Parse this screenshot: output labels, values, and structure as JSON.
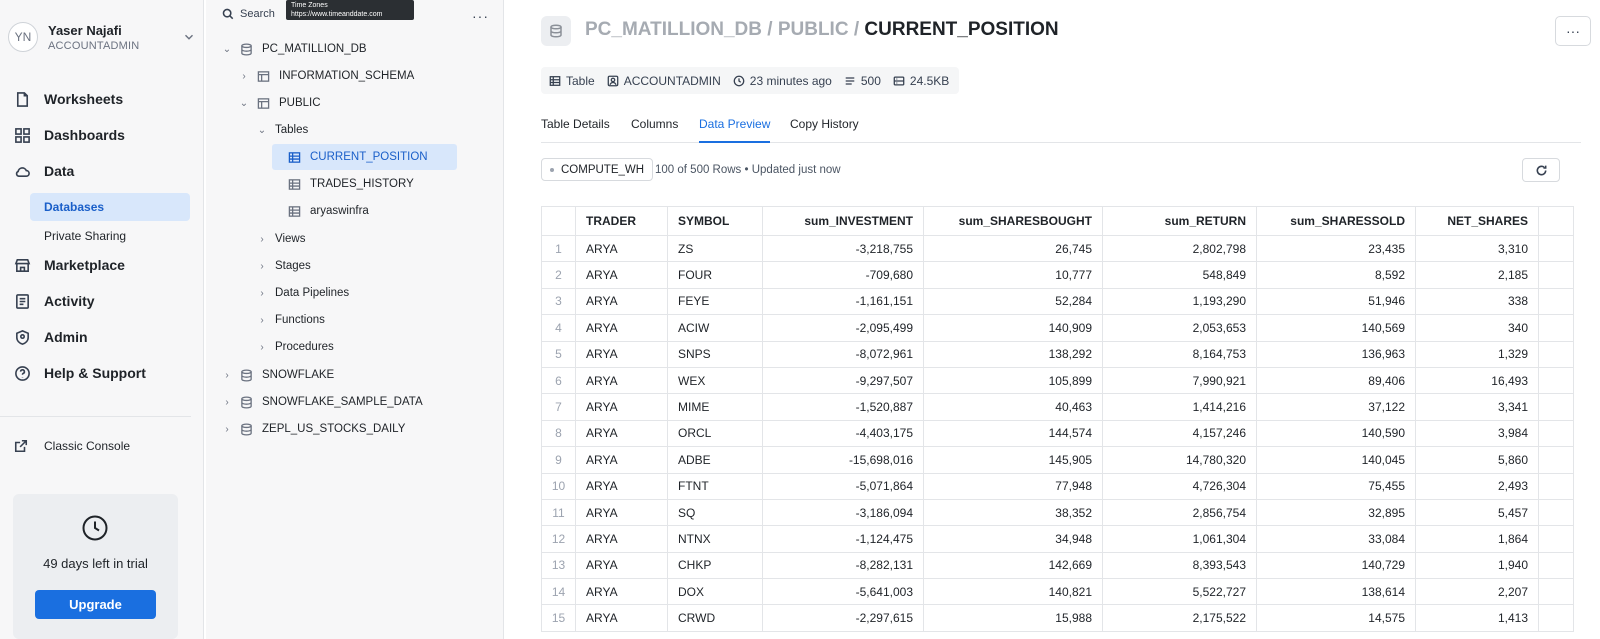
{
  "user": {
    "initials": "YN",
    "name": "Yaser Najafi",
    "role": "ACCOUNTADMIN"
  },
  "nav": {
    "worksheets": "Worksheets",
    "dashboards": "Dashboards",
    "data": "Data",
    "databases": "Databases",
    "private_sharing": "Private Sharing",
    "marketplace": "Marketplace",
    "activity": "Activity",
    "admin": "Admin",
    "help": "Help & Support",
    "classic_console": "Classic Console"
  },
  "trial": {
    "text": "49 days left in trial",
    "upgrade_label": "Upgrade"
  },
  "browser": {
    "search_label": "Search",
    "tooltip_title": "Time Zones",
    "tooltip_url": "https://www.timeanddate.com",
    "tree": {
      "db": "PC_MATILLION_DB",
      "info_schema": "INFORMATION_SCHEMA",
      "public": "PUBLIC",
      "tables": "Tables",
      "current_position": "CURRENT_POSITION",
      "trades_history": "TRADES_HISTORY",
      "aryaswinfra": "aryaswinfra",
      "views": "Views",
      "stages": "Stages",
      "data_pipelines": "Data Pipelines",
      "functions": "Functions",
      "procedures": "Procedures",
      "snowflake": "SNOWFLAKE",
      "snowflake_sample": "SNOWFLAKE_SAMPLE_DATA",
      "zepl": "ZEPL_US_STOCKS_DAILY"
    }
  },
  "header": {
    "path_db": "PC_MATILLION_DB",
    "path_schema": "PUBLIC",
    "sep": " / ",
    "object": "CURRENT_POSITION",
    "more": "···"
  },
  "meta": {
    "kind": "Table",
    "owner": "ACCOUNTADMIN",
    "updated": "23 minutes ago",
    "rows": "500",
    "size": "24.5KB"
  },
  "tabs": {
    "details": "Table Details",
    "columns": "Columns",
    "preview": "Data Preview",
    "copy_history": "Copy History"
  },
  "toolbar": {
    "warehouse": "COMPUTE_WH",
    "rows_info": "100 of 500 Rows • Updated just now"
  },
  "table": {
    "columns": [
      "TRADER",
      "SYMBOL",
      "sum_INVESTMENT",
      "sum_SHARESBOUGHT",
      "sum_RETURN",
      "sum_SHARESSOLD",
      "NET_SHARES"
    ],
    "rows": [
      [
        "1",
        "ARYA",
        "ZS",
        "-3,218,755",
        "26,745",
        "2,802,798",
        "23,435",
        "3,310"
      ],
      [
        "2",
        "ARYA",
        "FOUR",
        "-709,680",
        "10,777",
        "548,849",
        "8,592",
        "2,185"
      ],
      [
        "3",
        "ARYA",
        "FEYE",
        "-1,161,151",
        "52,284",
        "1,193,290",
        "51,946",
        "338"
      ],
      [
        "4",
        "ARYA",
        "ACIW",
        "-2,095,499",
        "140,909",
        "2,053,653",
        "140,569",
        "340"
      ],
      [
        "5",
        "ARYA",
        "SNPS",
        "-8,072,961",
        "138,292",
        "8,164,753",
        "136,963",
        "1,329"
      ],
      [
        "6",
        "ARYA",
        "WEX",
        "-9,297,507",
        "105,899",
        "7,990,921",
        "89,406",
        "16,493"
      ],
      [
        "7",
        "ARYA",
        "MIME",
        "-1,520,887",
        "40,463",
        "1,414,216",
        "37,122",
        "3,341"
      ],
      [
        "8",
        "ARYA",
        "ORCL",
        "-4,403,175",
        "144,574",
        "4,157,246",
        "140,590",
        "3,984"
      ],
      [
        "9",
        "ARYA",
        "ADBE",
        "-15,698,016",
        "145,905",
        "14,780,320",
        "140,045",
        "5,860"
      ],
      [
        "10",
        "ARYA",
        "FTNT",
        "-5,071,864",
        "77,948",
        "4,726,304",
        "75,455",
        "2,493"
      ],
      [
        "11",
        "ARYA",
        "SQ",
        "-3,186,094",
        "38,352",
        "2,856,754",
        "32,895",
        "5,457"
      ],
      [
        "12",
        "ARYA",
        "NTNX",
        "-1,124,475",
        "34,948",
        "1,061,304",
        "33,084",
        "1,864"
      ],
      [
        "13",
        "ARYA",
        "CHKP",
        "-8,282,131",
        "142,669",
        "8,393,543",
        "140,729",
        "1,940"
      ],
      [
        "14",
        "ARYA",
        "DOX",
        "-5,641,003",
        "140,821",
        "5,522,727",
        "138,614",
        "2,207"
      ],
      [
        "15",
        "ARYA",
        "CRWD",
        "-2,297,615",
        "15,988",
        "2,175,522",
        "14,575",
        "1,413"
      ]
    ]
  },
  "colors": {
    "accent": "#1a6fe0",
    "selected_bg": "#d8e7fb"
  }
}
